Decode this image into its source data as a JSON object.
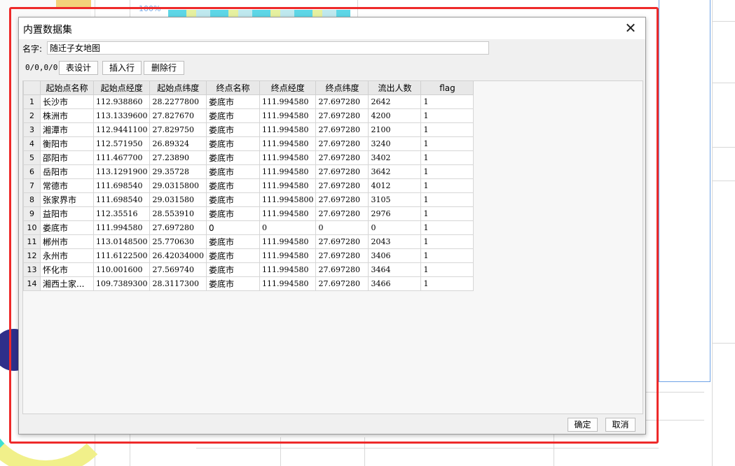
{
  "background": {
    "percent_label": "100%"
  },
  "dialog": {
    "title": "内置数据集",
    "close_symbol": "✕",
    "name_label": "名字:",
    "name_value": "随迁子女地图",
    "position_label": "0/0,0/0",
    "buttons": {
      "table_design": "表设计",
      "insert_row": "插入行",
      "delete_row": "删除行"
    },
    "footer": {
      "ok": "确定",
      "cancel": "取消"
    }
  },
  "table": {
    "headers": [
      "起始点名称",
      "起始点经度",
      "起始点纬度",
      "终点名称",
      "终点经度",
      "终点纬度",
      "流出人数",
      "flag"
    ],
    "rows": [
      [
        "1",
        "长沙市",
        "112.938860",
        "28.2277800",
        "娄底市",
        "111.994580",
        "27.697280",
        "2642",
        "1"
      ],
      [
        "2",
        "株洲市",
        "113.1339600",
        "27.827670",
        "娄底市",
        "111.994580",
        "27.697280",
        "4200",
        "1"
      ],
      [
        "3",
        "湘潭市",
        "112.9441100",
        "27.829750",
        "娄底市",
        "111.994580",
        "27.697280",
        "2100",
        "1"
      ],
      [
        "4",
        "衡阳市",
        "112.571950",
        "26.89324",
        "娄底市",
        "111.994580",
        "27.697280",
        "3240",
        "1"
      ],
      [
        "5",
        "邵阳市",
        "111.467700",
        "27.23890",
        "娄底市",
        "111.994580",
        "27.697280",
        "3402",
        "1"
      ],
      [
        "6",
        "岳阳市",
        "113.1291900",
        "29.35728",
        "娄底市",
        "111.994580",
        "27.697280",
        "3642",
        "1"
      ],
      [
        "7",
        "常德市",
        "111.698540",
        "29.0315800",
        "娄底市",
        "111.994580",
        "27.697280",
        "4012",
        "1"
      ],
      [
        "8",
        "张家界市",
        "111.698540",
        "29.031580",
        "娄底市",
        "111.9945800",
        "27.697280",
        "3105",
        "1"
      ],
      [
        "9",
        "益阳市",
        "112.35516",
        "28.553910",
        "娄底市",
        "111.994580",
        "27.697280",
        "2976",
        "1"
      ],
      [
        "10",
        "娄底市",
        "111.994580",
        "27.697280",
        "0",
        "0",
        "0",
        "0",
        "1"
      ],
      [
        "11",
        "郴州市",
        "113.0148500",
        "25.770630",
        "娄底市",
        "111.994580",
        "27.697280",
        "2043",
        "1"
      ],
      [
        "12",
        "永州市",
        "111.6122500",
        "26.42034000",
        "娄底市",
        "111.994580",
        "27.697280",
        "3406",
        "1"
      ],
      [
        "13",
        "怀化市",
        "110.001600",
        "27.569740",
        "娄底市",
        "111.994580",
        "27.697280",
        "3464",
        "1"
      ],
      [
        "14",
        "湘西土家...",
        "109.7389300",
        "28.3117300",
        "娄底市",
        "111.994580",
        "27.697280",
        "3466",
        "1"
      ]
    ]
  },
  "colors": {
    "annotation_red": "#ee2a2a",
    "dialog_bg": "#f0f0f0",
    "header_bg": "#e8e8e8",
    "accent_blue": "#6ea2e6"
  }
}
